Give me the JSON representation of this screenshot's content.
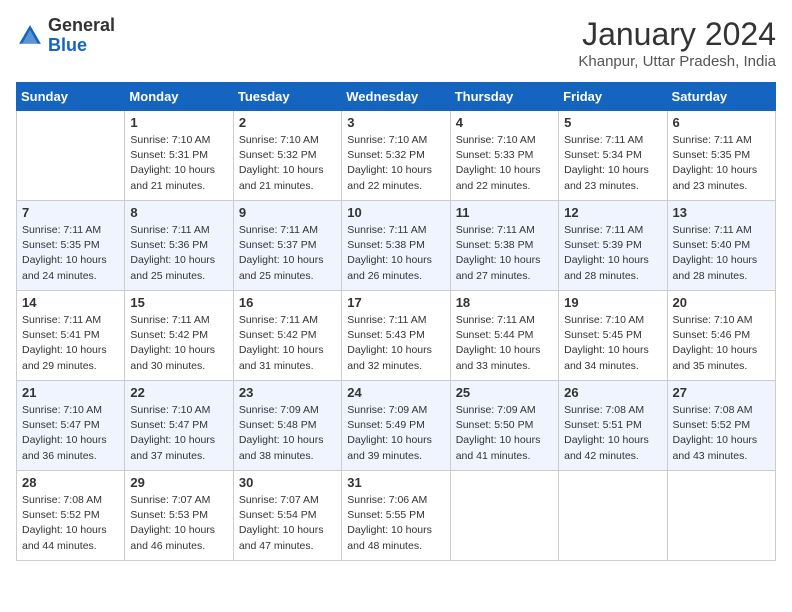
{
  "header": {
    "logo_general": "General",
    "logo_blue": "Blue",
    "month_year": "January 2024",
    "location": "Khanpur, Uttar Pradesh, India"
  },
  "days_of_week": [
    "Sunday",
    "Monday",
    "Tuesday",
    "Wednesday",
    "Thursday",
    "Friday",
    "Saturday"
  ],
  "weeks": [
    [
      {
        "day": "",
        "info": ""
      },
      {
        "day": "1",
        "info": "Sunrise: 7:10 AM\nSunset: 5:31 PM\nDaylight: 10 hours\nand 21 minutes."
      },
      {
        "day": "2",
        "info": "Sunrise: 7:10 AM\nSunset: 5:32 PM\nDaylight: 10 hours\nand 21 minutes."
      },
      {
        "day": "3",
        "info": "Sunrise: 7:10 AM\nSunset: 5:32 PM\nDaylight: 10 hours\nand 22 minutes."
      },
      {
        "day": "4",
        "info": "Sunrise: 7:10 AM\nSunset: 5:33 PM\nDaylight: 10 hours\nand 22 minutes."
      },
      {
        "day": "5",
        "info": "Sunrise: 7:11 AM\nSunset: 5:34 PM\nDaylight: 10 hours\nand 23 minutes."
      },
      {
        "day": "6",
        "info": "Sunrise: 7:11 AM\nSunset: 5:35 PM\nDaylight: 10 hours\nand 23 minutes."
      }
    ],
    [
      {
        "day": "7",
        "info": "Sunrise: 7:11 AM\nSunset: 5:35 PM\nDaylight: 10 hours\nand 24 minutes."
      },
      {
        "day": "8",
        "info": "Sunrise: 7:11 AM\nSunset: 5:36 PM\nDaylight: 10 hours\nand 25 minutes."
      },
      {
        "day": "9",
        "info": "Sunrise: 7:11 AM\nSunset: 5:37 PM\nDaylight: 10 hours\nand 25 minutes."
      },
      {
        "day": "10",
        "info": "Sunrise: 7:11 AM\nSunset: 5:38 PM\nDaylight: 10 hours\nand 26 minutes."
      },
      {
        "day": "11",
        "info": "Sunrise: 7:11 AM\nSunset: 5:38 PM\nDaylight: 10 hours\nand 27 minutes."
      },
      {
        "day": "12",
        "info": "Sunrise: 7:11 AM\nSunset: 5:39 PM\nDaylight: 10 hours\nand 28 minutes."
      },
      {
        "day": "13",
        "info": "Sunrise: 7:11 AM\nSunset: 5:40 PM\nDaylight: 10 hours\nand 28 minutes."
      }
    ],
    [
      {
        "day": "14",
        "info": "Sunrise: 7:11 AM\nSunset: 5:41 PM\nDaylight: 10 hours\nand 29 minutes."
      },
      {
        "day": "15",
        "info": "Sunrise: 7:11 AM\nSunset: 5:42 PM\nDaylight: 10 hours\nand 30 minutes."
      },
      {
        "day": "16",
        "info": "Sunrise: 7:11 AM\nSunset: 5:42 PM\nDaylight: 10 hours\nand 31 minutes."
      },
      {
        "day": "17",
        "info": "Sunrise: 7:11 AM\nSunset: 5:43 PM\nDaylight: 10 hours\nand 32 minutes."
      },
      {
        "day": "18",
        "info": "Sunrise: 7:11 AM\nSunset: 5:44 PM\nDaylight: 10 hours\nand 33 minutes."
      },
      {
        "day": "19",
        "info": "Sunrise: 7:10 AM\nSunset: 5:45 PM\nDaylight: 10 hours\nand 34 minutes."
      },
      {
        "day": "20",
        "info": "Sunrise: 7:10 AM\nSunset: 5:46 PM\nDaylight: 10 hours\nand 35 minutes."
      }
    ],
    [
      {
        "day": "21",
        "info": "Sunrise: 7:10 AM\nSunset: 5:47 PM\nDaylight: 10 hours\nand 36 minutes."
      },
      {
        "day": "22",
        "info": "Sunrise: 7:10 AM\nSunset: 5:47 PM\nDaylight: 10 hours\nand 37 minutes."
      },
      {
        "day": "23",
        "info": "Sunrise: 7:09 AM\nSunset: 5:48 PM\nDaylight: 10 hours\nand 38 minutes."
      },
      {
        "day": "24",
        "info": "Sunrise: 7:09 AM\nSunset: 5:49 PM\nDaylight: 10 hours\nand 39 minutes."
      },
      {
        "day": "25",
        "info": "Sunrise: 7:09 AM\nSunset: 5:50 PM\nDaylight: 10 hours\nand 41 minutes."
      },
      {
        "day": "26",
        "info": "Sunrise: 7:08 AM\nSunset: 5:51 PM\nDaylight: 10 hours\nand 42 minutes."
      },
      {
        "day": "27",
        "info": "Sunrise: 7:08 AM\nSunset: 5:52 PM\nDaylight: 10 hours\nand 43 minutes."
      }
    ],
    [
      {
        "day": "28",
        "info": "Sunrise: 7:08 AM\nSunset: 5:52 PM\nDaylight: 10 hours\nand 44 minutes."
      },
      {
        "day": "29",
        "info": "Sunrise: 7:07 AM\nSunset: 5:53 PM\nDaylight: 10 hours\nand 46 minutes."
      },
      {
        "day": "30",
        "info": "Sunrise: 7:07 AM\nSunset: 5:54 PM\nDaylight: 10 hours\nand 47 minutes."
      },
      {
        "day": "31",
        "info": "Sunrise: 7:06 AM\nSunset: 5:55 PM\nDaylight: 10 hours\nand 48 minutes."
      },
      {
        "day": "",
        "info": ""
      },
      {
        "day": "",
        "info": ""
      },
      {
        "day": "",
        "info": ""
      }
    ]
  ]
}
